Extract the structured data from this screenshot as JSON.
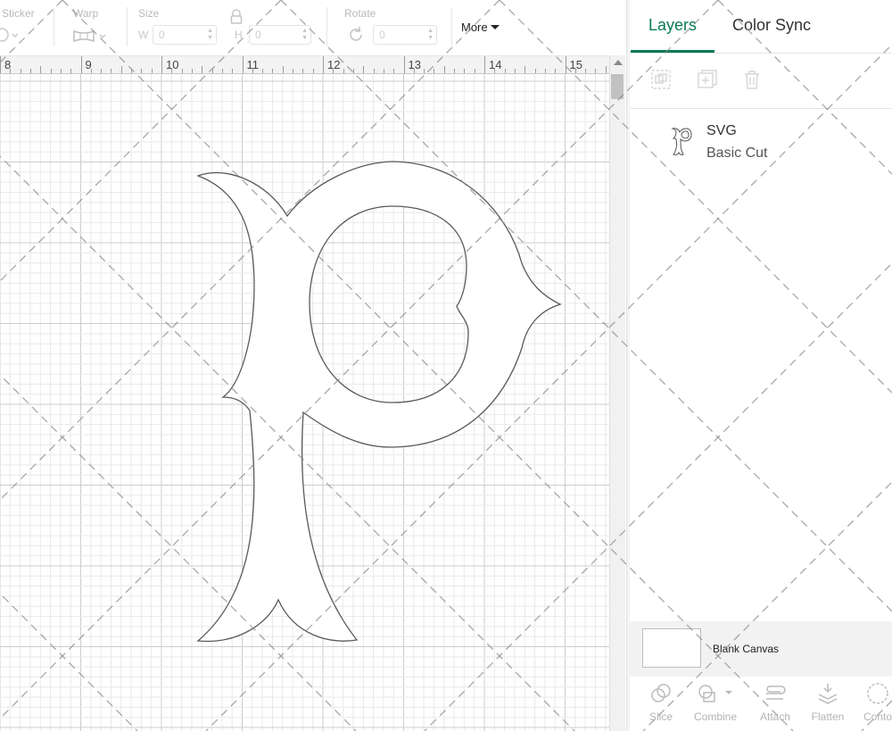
{
  "toolbar": {
    "sticker_label": "Sticker",
    "warp_label": "Warp",
    "size_label": "Size",
    "width_prefix": "W",
    "width_value": "0",
    "height_prefix": "H",
    "height_value": "0",
    "rotate_label": "Rotate",
    "rotate_value": "0",
    "more_label": "More"
  },
  "ruler": {
    "numbers": [
      "8",
      "9",
      "10",
      "11",
      "12",
      "13",
      "14",
      "15"
    ]
  },
  "panel": {
    "tabs": [
      {
        "label": "Layers",
        "active": true
      },
      {
        "label": "Color Sync",
        "active": false
      }
    ],
    "layer_tools": [
      "group-icon",
      "duplicate-icon",
      "delete-icon"
    ],
    "layers": [
      {
        "name": "SVG",
        "operation": "Basic Cut",
        "icon": "letter-p-thumbnail"
      }
    ],
    "blank_canvas_label": "Blank Canvas",
    "bottom_tools": [
      {
        "label": "Slice",
        "icon": "slice-icon"
      },
      {
        "label": "Combine",
        "icon": "combine-icon"
      },
      {
        "label": "Attach",
        "icon": "attach-icon"
      },
      {
        "label": "Flatten",
        "icon": "flatten-icon"
      },
      {
        "label": "Conto",
        "icon": "contour-icon"
      }
    ]
  },
  "colors": {
    "accent": "#0a7a55",
    "grid_minor": "#e9e9e9",
    "grid_major": "#cdcdcd",
    "shape_stroke": "#5a5a5a"
  }
}
